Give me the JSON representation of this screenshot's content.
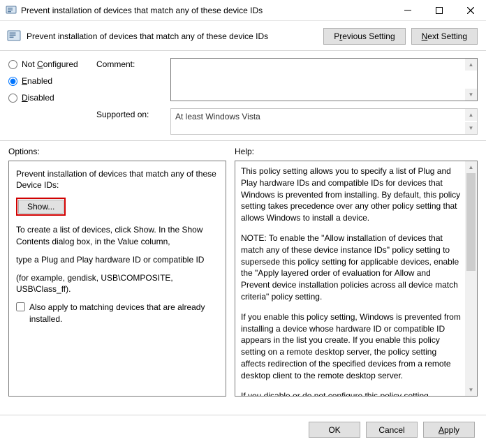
{
  "window": {
    "title": "Prevent installation of devices that match any of these device IDs"
  },
  "header": {
    "policy_name": "Prevent installation of devices that match any of these device IDs",
    "previous_setting_pre": "P",
    "previous_setting_ul": "r",
    "previous_setting_post": "evious Setting",
    "next_setting_pre": "",
    "next_setting_ul": "N",
    "next_setting_post": "ext Setting"
  },
  "radios": {
    "not_configured_ul": "C",
    "not_configured_pre": "Not ",
    "not_configured_post": "onfigured",
    "enabled_ul": "E",
    "enabled_post": "nabled",
    "disabled_ul": "D",
    "disabled_post": "isabled",
    "selected": "enabled"
  },
  "fields": {
    "comment_label": "Comment:",
    "comment_value": "",
    "supported_label": "Supported on:",
    "supported_value": "At least Windows Vista"
  },
  "labels": {
    "options": "Options:",
    "help": "Help:"
  },
  "options": {
    "heading": "Prevent installation of devices that match any of these Device IDs:",
    "show_button": "Show...",
    "instr1": "To create a list of devices, click Show. In the Show Contents dialog box, in the Value column,",
    "instr2": "type a Plug and Play hardware ID or compatible ID",
    "instr3": "(for example, gendisk, USB\\COMPOSITE, USB\\Class_ff).",
    "checkbox_label": "Also apply to matching devices that are already installed.",
    "checkbox_checked": false
  },
  "help": {
    "p1": "This policy setting allows you to specify a list of Plug and Play hardware IDs and compatible IDs for devices that Windows is prevented from installing. By default, this policy setting takes precedence over any other policy setting that allows Windows to install a device.",
    "p2": "NOTE: To enable the \"Allow installation of devices that match any of these device instance IDs\" policy setting to supersede this policy setting for applicable devices, enable the \"Apply layered order of evaluation for Allow and Prevent device installation policies across all device match criteria\" policy setting.",
    "p3": "If you enable this policy setting, Windows is prevented from installing a device whose hardware ID or compatible ID appears in the list you create. If you enable this policy setting on a remote desktop server, the policy setting affects redirection of the specified devices from a remote desktop client to the remote desktop server.",
    "p4": "If you disable or do not configure this policy setting, devices can be installed and updated as allowed or prevented by other policy"
  },
  "footer": {
    "ok": "OK",
    "cancel": "Cancel",
    "apply_ul": "A",
    "apply_post": "pply"
  }
}
